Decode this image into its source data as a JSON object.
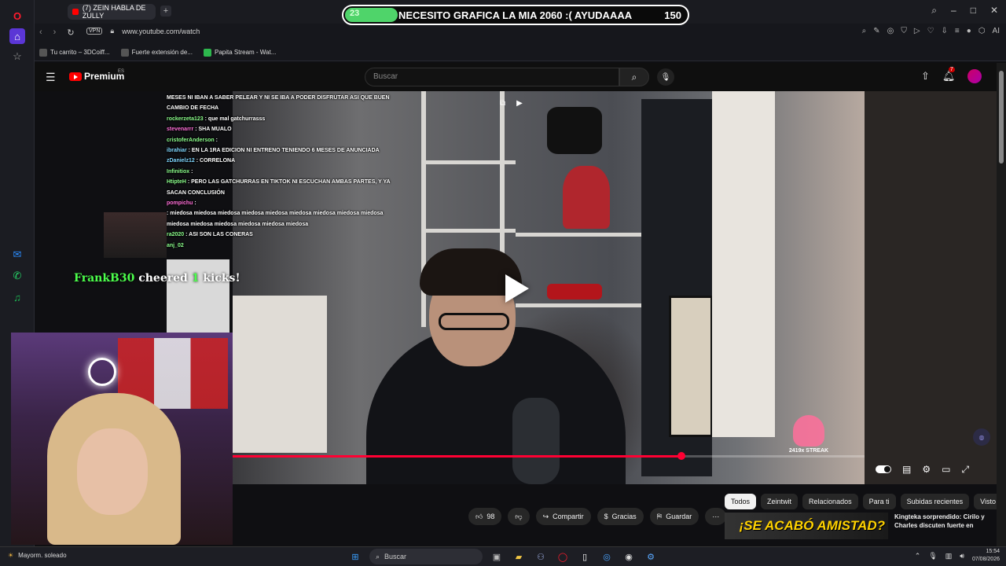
{
  "browser": {
    "tab_title": "(7) ZEIN HABLA DE ZULLY",
    "url": "www.youtube.com/watch",
    "vpn_label": "VPN",
    "ai_label": "AI",
    "bookmarks": [
      "Tu carrito – 3DCoiff...",
      "Fuerte extensión de...",
      "Papita Stream - Wat..."
    ]
  },
  "goal_banner": {
    "count": "23",
    "title": "NECESITO GRAFICA LA MIA 2060 :( AYUDAAAA",
    "goal": "150",
    "progress": 0.153,
    "color": "#4fd46a"
  },
  "youtube": {
    "logo_label": "Premium",
    "logo_region": "ES",
    "search_placeholder": "Buscar",
    "notifications_count": "7",
    "video_progress": 0.71,
    "chips": [
      "Todos",
      "Zeintwit",
      "Relacionados",
      "Para ti",
      "Subidas recientes",
      "Visto"
    ],
    "actions": {
      "likes": "98",
      "share": "Compartir",
      "thanks": "Gracias",
      "save": "Guardar"
    },
    "recommendation": {
      "thumb_text": "¡SE ACABÓ AMISTAD?",
      "title": "Kingteka sorprendido: Cirilo y Charles discuten fuerte en"
    }
  },
  "stream_overlay": {
    "chat": [
      {
        "user": "",
        "msg": "MESES NI IBAN A SABER PELEAR Y NI SE IBA A PODER DISFRUTAR ASI QUE BUEN CAMBIO DE FECHA"
      },
      {
        "user": "rockerzeta123",
        "msg": ": que mal gatchurrasss"
      },
      {
        "user": "stevenarrr",
        "msg": ": SHA MUALO"
      },
      {
        "user": "cristoferAnderson",
        "msg": ":"
      },
      {
        "user": "ibrahiar",
        "msg": ": EN LA 1RA EDICION NI ENTRENO TENIENDO 6 MESES DE ANUNCIADA"
      },
      {
        "user": "zDanielz12",
        "msg": ": CORRELONA"
      },
      {
        "user": "Infinitiox",
        "msg": ":"
      },
      {
        "user": "HtipteH",
        "msg": ": PERO LAS GATCHURRAS EN TIKTOK NI ESCUCHAN AMBAS PARTES, Y YA SACAN CONCLUSIÓN"
      },
      {
        "user": "pompichu",
        "msg": ":"
      },
      {
        "user": "",
        "msg": ": miedosa miedosa miedosa miedosa miedosa miedosa miedosa miedosa miedosa miedosa miedosa miedosa miedosa miedosa miedosa"
      },
      {
        "user": "ra2020",
        "msg": ": ASI SON LAS CONERAS"
      },
      {
        "user": "anj_02",
        "msg": ""
      }
    ],
    "cheer": {
      "user": "FrankB30",
      "word": "cheered",
      "amount": "1",
      "unit": "kicks!"
    },
    "streak": "2419x STREAK"
  },
  "taskbar": {
    "weather": "Mayorm. soleado",
    "search_label": "Buscar",
    "time": "15:54",
    "date": "07/08/2026"
  }
}
